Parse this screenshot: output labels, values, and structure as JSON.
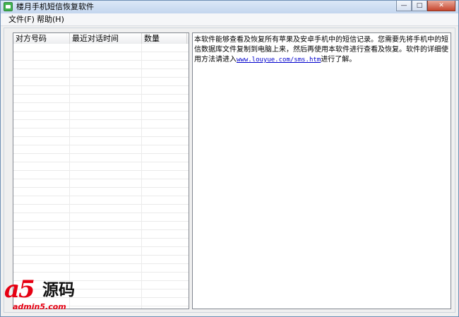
{
  "window": {
    "title": "楼月手机短信恢复软件",
    "controls": {
      "minimize": "—",
      "maximize": "□",
      "close": "✕"
    }
  },
  "menu": {
    "items": [
      {
        "label": "文件(F)"
      },
      {
        "label": "帮助(H)"
      }
    ]
  },
  "list": {
    "columns": [
      "对方号码",
      "最近对话时间",
      "数量"
    ],
    "rows": []
  },
  "info": {
    "text_before_link": "本软件能够查看及恢复所有苹果及安卓手机中的短信记录。您需要先将手机中的短信数据库文件复制到电脑上来，然后再使用本软件进行查看及恢复。软件的详细使用方法请进入",
    "link_text": "www.louyue.com/sms.htm",
    "text_after_link": "进行了解。"
  },
  "watermark": {
    "logo": "a5",
    "name": "源码",
    "url": "admin5.com"
  },
  "colors": {
    "titlebar": "#c3d6ee",
    "link": "#0000cc",
    "watermark_red": "#e60012"
  }
}
